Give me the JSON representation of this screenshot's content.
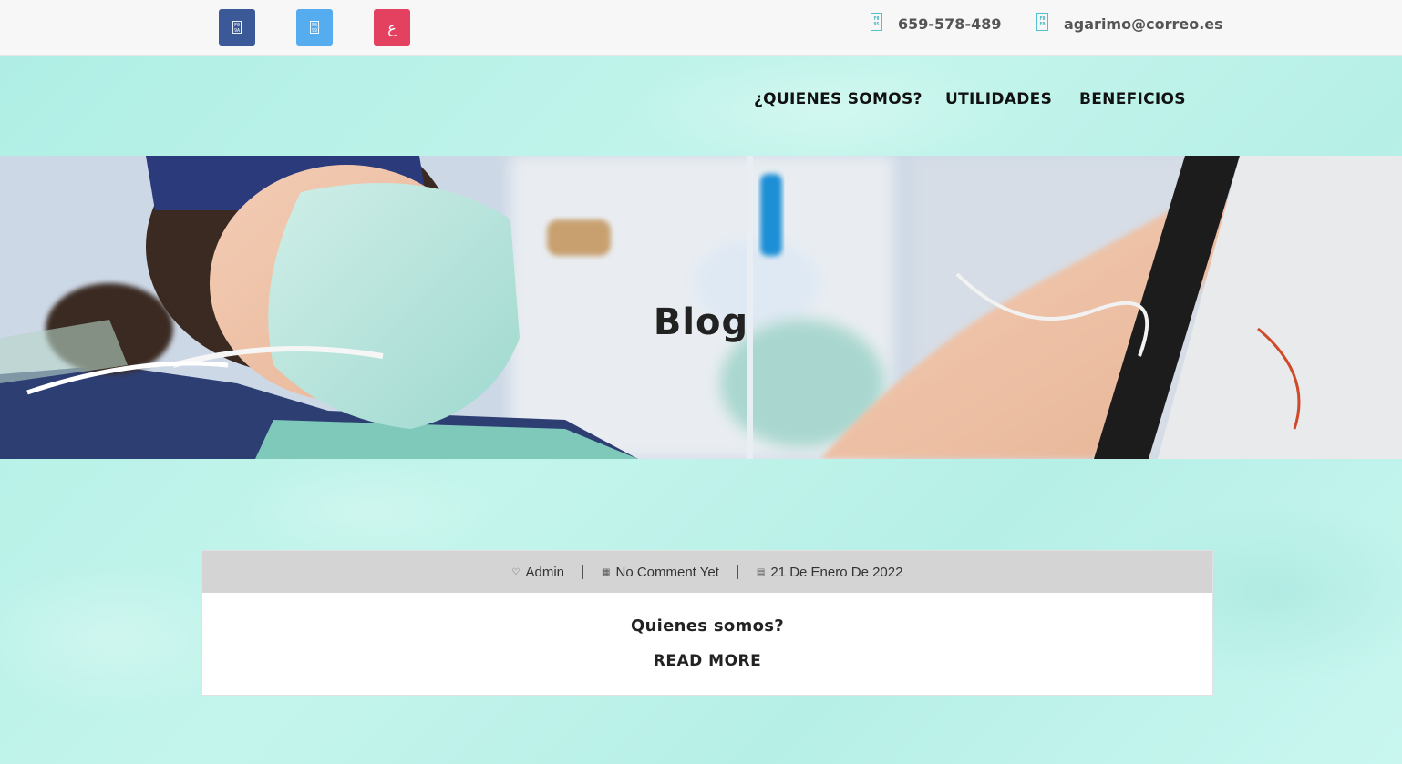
{
  "topbar": {
    "social": [
      {
        "name": "facebook",
        "icon": "facebook-icon",
        "glyph": "F0 9A",
        "color": "#3b5998"
      },
      {
        "name": "twitter",
        "icon": "twitter-icon",
        "glyph": "F0 99",
        "color": "#55acee"
      },
      {
        "name": "instagram",
        "icon": "instagram-icon",
        "glyph": "ﻉ",
        "color": "#e4405f"
      }
    ],
    "phone": {
      "icon": "phone-icon",
      "glyph": "F0 95",
      "text": "659-578-489"
    },
    "email": {
      "icon": "envelope-icon",
      "glyph": "F0 E0",
      "text": "agarimo@correo.es"
    }
  },
  "nav": {
    "items": [
      "¿QUIENES SOMOS?",
      "UTILIDADES",
      "BENEFICIOS"
    ]
  },
  "hero": {
    "title": "Blog"
  },
  "post": {
    "meta": {
      "author": "Admin",
      "comments": "No Comment Yet",
      "date": "21 De Enero De 2022"
    },
    "title": "Quienes somos?",
    "read_more": "READ MORE"
  },
  "colors": {
    "facebook": "#3b5998",
    "twitter": "#55acee",
    "instagram": "#e4405f",
    "accent": "#4fc3d0",
    "meta_bar": "#d4d4d4"
  }
}
